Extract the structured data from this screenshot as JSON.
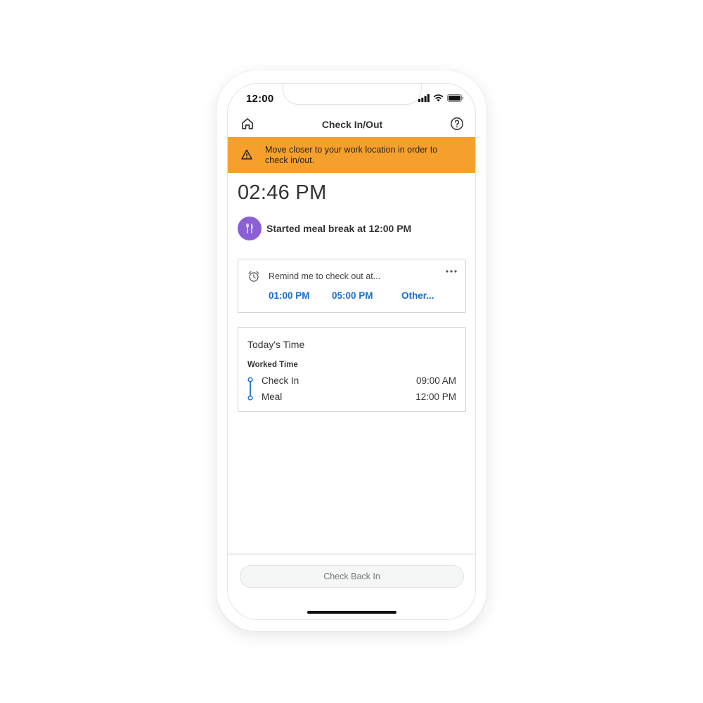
{
  "status_bar": {
    "time": "12:00"
  },
  "header": {
    "title": "Check In/Out"
  },
  "alert": {
    "message": "Move closer to your work location in order to check in/out."
  },
  "current_time": "02:46 PM",
  "meal_status": "Started meal break at 12:00 PM",
  "reminder": {
    "label": "Remind me to check out at...",
    "options": [
      "01:00 PM",
      "05:00 PM",
      "Other..."
    ]
  },
  "today": {
    "title": "Today's Time",
    "section_label": "Worked Time",
    "entries": [
      {
        "label": "Check In",
        "time": "09:00 AM"
      },
      {
        "label": "Meal",
        "time": "12:00 PM"
      }
    ]
  },
  "footer": {
    "button_label": "Check Back In"
  },
  "colors": {
    "alert_background": "#f5a02d",
    "accent_blue": "#1a6fd1",
    "meal_avatar": "#8b5fd6"
  },
  "icons": [
    "home-icon",
    "help-icon",
    "warning-icon",
    "fork-knife-icon",
    "alarm-clock-icon",
    "more-icon",
    "signal-icon",
    "wifi-icon",
    "battery-icon"
  ]
}
